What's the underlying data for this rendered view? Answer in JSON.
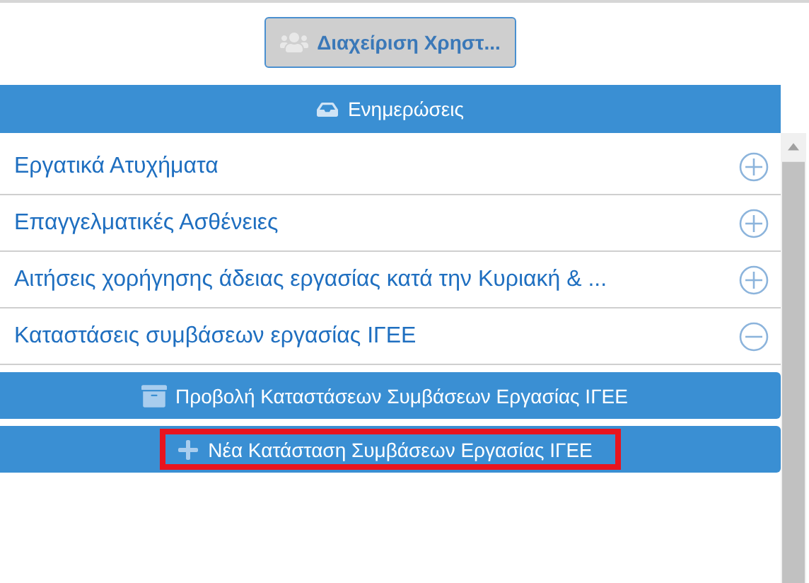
{
  "user_button": {
    "label": "Διαχείριση Χρηστ...",
    "disabled": true
  },
  "header": {
    "label": "Ενημερώσεις"
  },
  "items": [
    {
      "label": "Εργατικά Ατυχήματα",
      "expanded": false
    },
    {
      "label": "Επαγγελματικές Ασθένειες",
      "expanded": false
    },
    {
      "label": "Αιτήσεις χορήγησης άδειας εργασίας κατά την Κυριακή & ...",
      "expanded": false
    },
    {
      "label": "Καταστάσεις συμβάσεων εργασίας ΙΓΕΕ",
      "expanded": true
    }
  ],
  "actions": [
    {
      "label": "Προβολή Καταστάσεων Συμβάσεων Εργασίας ΙΓΕΕ",
      "kind": "view",
      "highlighted": false
    },
    {
      "label": "Νέα Κατάσταση Συμβάσεων Εργασίας ΙΓΕΕ",
      "kind": "add",
      "highlighted": true
    }
  ]
}
